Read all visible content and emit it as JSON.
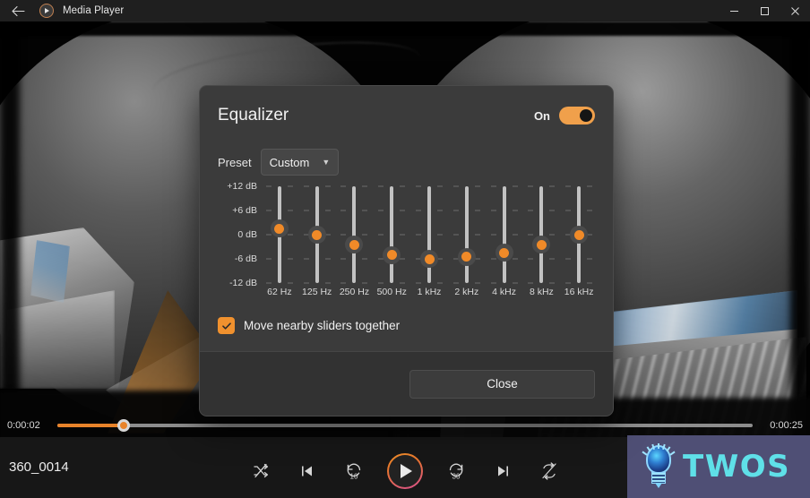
{
  "titlebar": {
    "back_icon": "back-arrow-icon",
    "app_icon": "media-player-icon",
    "title": "Media Player",
    "minimize_label": "minimize-icon",
    "maximize_label": "maximize-icon",
    "close_label": "close-icon"
  },
  "player": {
    "current_time": "0:00:02",
    "duration": "0:00:25",
    "progress_percent": 9.6,
    "filename": "360_0014",
    "controls": [
      {
        "name": "shuffle-button",
        "label": "Shuffle"
      },
      {
        "name": "previous-button",
        "label": "Previous"
      },
      {
        "name": "rewind-10-button",
        "label": "10"
      },
      {
        "name": "play-button",
        "label": "Play"
      },
      {
        "name": "forward-30-button",
        "label": "30"
      },
      {
        "name": "next-button",
        "label": "Next"
      },
      {
        "name": "repeat-button",
        "label": "Repeat off"
      }
    ],
    "accent_color": "#e8832a",
    "play_ring_gradient": [
      "#f0932b",
      "#d8508f"
    ]
  },
  "watermark": {
    "text": "TWOS",
    "icon": "lightbulb-icon",
    "background": "#4f4f75",
    "text_color": "#5fe0e8"
  },
  "dialog": {
    "title": "Equalizer",
    "toggle": {
      "label": "On",
      "state": true,
      "color": "#f0a04b"
    },
    "preset": {
      "label": "Preset",
      "value": "Custom",
      "chevron": "chevron-down-icon"
    },
    "checkbox": {
      "label": "Move nearby sliders together",
      "checked": true,
      "color": "#f0912e"
    },
    "close_button": "Close"
  },
  "chart_data": {
    "type": "bar",
    "title": "Equalizer",
    "xlabel": "",
    "ylabel": "dB",
    "ylim": [
      -12,
      12
    ],
    "y_ticks": [
      "+12 dB",
      "+6 dB",
      "0 dB",
      "-6 dB",
      "-12 dB"
    ],
    "y_tick_values": [
      12,
      6,
      0,
      -6,
      -12
    ],
    "categories": [
      "62 Hz",
      "125 Hz",
      "250 Hz",
      "500 Hz",
      "1 kHz",
      "2 kHz",
      "4 kHz",
      "8 kHz",
      "16 kHz"
    ],
    "values": [
      1.5,
      0,
      -2.5,
      -5,
      -6,
      -5.5,
      -4.5,
      -2.5,
      0
    ],
    "units": "dB",
    "grid": true,
    "legend": "none"
  }
}
